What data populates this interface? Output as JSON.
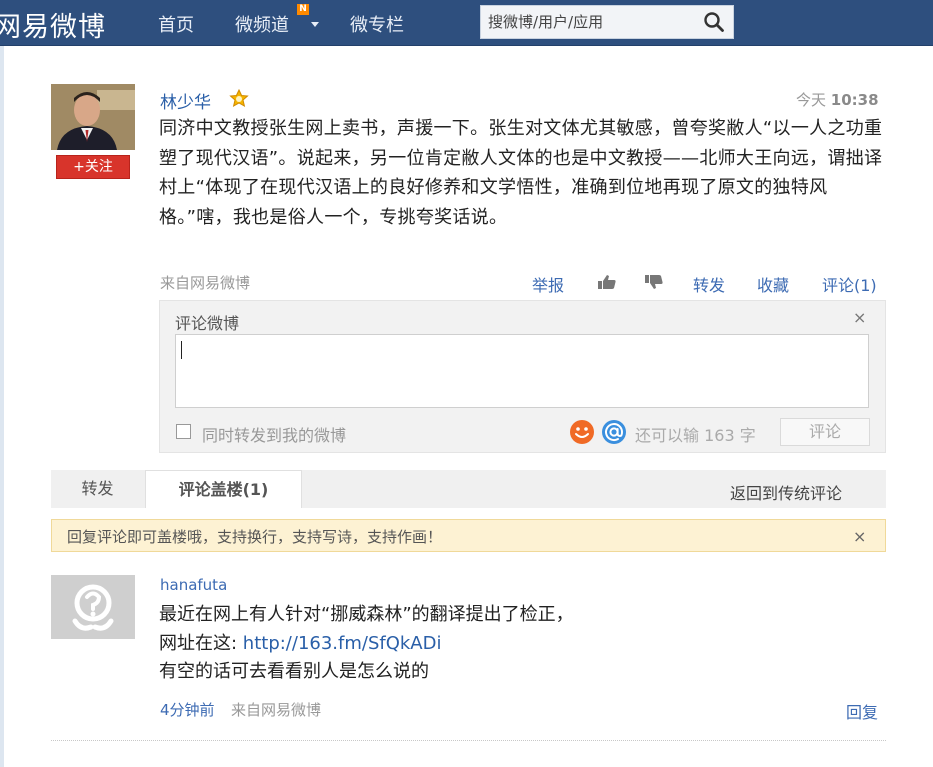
{
  "nav": {
    "logo": "网易微博",
    "home": "首页",
    "channel": "微频道",
    "channel_badge": "N",
    "column": "微专栏",
    "search_placeholder": "搜微博/用户/应用"
  },
  "post": {
    "author": "林少华",
    "time_label": "今天",
    "time_value": "10:38",
    "follow_label": "+关注",
    "text": "同济中文教授张生网上卖书，声援一下。张生对文体尤其敏感，曾夸奖敝人“以一人之功重塑了现代汉语”。说起来，另一位肯定敝人文体的也是中文教授——北师大王向远，谓拙译村上“体现了在现代汉语上的良好修养和文学悟性，准确到位地再现了原文的独特风格。”嗐，我也是俗人一个，专挑夸奖话说。",
    "source": "来自网易微博",
    "actions": {
      "report": "举报",
      "forward": "转发",
      "favorite": "收藏",
      "comment": "评论(1)"
    }
  },
  "comment_box": {
    "title": "评论微博",
    "close": "×",
    "also_forward": "同时转发到我的微博",
    "remaining": "还可以输 163 字",
    "submit": "评论"
  },
  "tabs": {
    "forward": "转发",
    "building": "评论盖楼(1)",
    "back": "返回到传统评论"
  },
  "notice": {
    "text": "回复评论即可盖楼哦，支持换行，支持写诗，支持作画！",
    "close": "×"
  },
  "comment": {
    "user": "hanafuta",
    "line1": "最近在网上有人针对“挪威森林”的翻译提出了检正，",
    "line2_prefix": "网址在这: ",
    "line2_link": "http://163.fm/SfQkADi",
    "line3": "有空的话可去看看别人是怎么说的",
    "time": "4分钟前",
    "source": "来自网易微博",
    "reply": "回复"
  },
  "colors": {
    "nav_bg": "#2e4f7e",
    "link_blue": "#3d6bb3",
    "follow_red": "#d8342b",
    "notice_bg": "#fdf2d3"
  }
}
